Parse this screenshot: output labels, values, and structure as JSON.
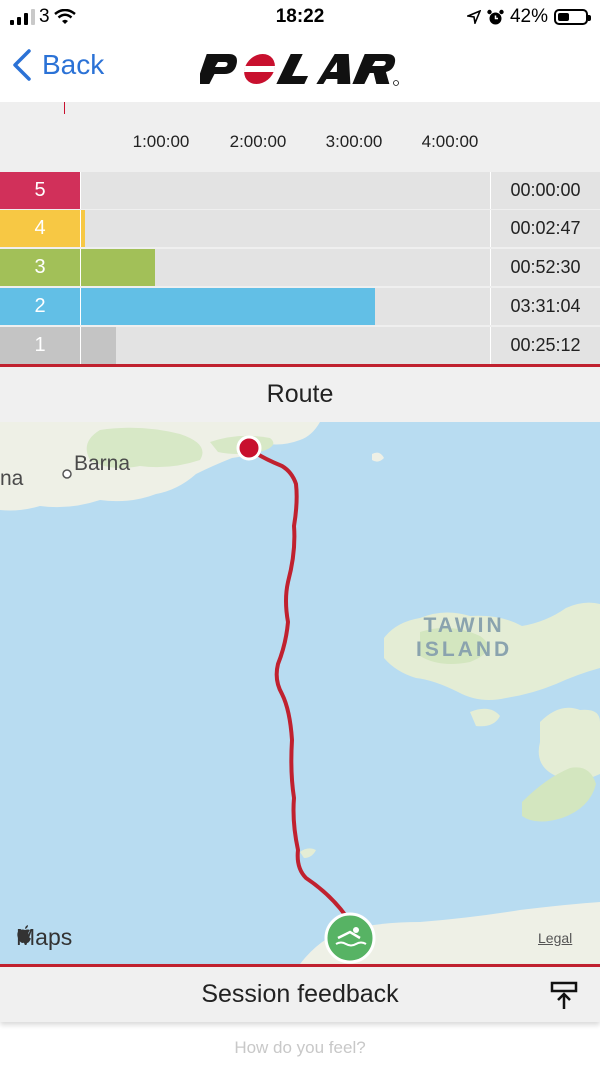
{
  "status_bar": {
    "carrier": "3",
    "time": "18:22",
    "battery_percent": "42%",
    "battery_level": 0.42,
    "icons": [
      "signal-bars-icon",
      "wifi-icon",
      "location-arrow-icon",
      "alarm-clock-icon",
      "battery-icon"
    ]
  },
  "nav": {
    "back_label": "Back",
    "brand": "POLAR"
  },
  "zones": {
    "axis_ticks": [
      "1:00:00",
      "2:00:00",
      "3:00:00",
      "4:00:00"
    ],
    "rows": [
      {
        "zone": "5",
        "time": "00:00:00",
        "fraction": 0.0,
        "color": "#d1305a"
      },
      {
        "zone": "4",
        "time": "00:02:47",
        "fraction": 0.011,
        "color": "#f7c844"
      },
      {
        "zone": "3",
        "time": "00:52:30",
        "fraction": 0.18,
        "color": "#a2c058"
      },
      {
        "zone": "2",
        "time": "03:31:04",
        "fraction": 0.72,
        "color": "#62bfe6"
      },
      {
        "zone": "1",
        "time": "00:25:12",
        "fraction": 0.086,
        "color": "#c4c4c4"
      }
    ]
  },
  "route": {
    "title": "Route",
    "place_labels": [
      "na",
      "Barna"
    ],
    "island_label_line1": "TAWIN",
    "island_label_line2": "ISLAND",
    "maps_credit": "Maps",
    "legal": "Legal",
    "route_color": "#c0212f",
    "start_icon": "swimmer-icon"
  },
  "feedback": {
    "title": "Session feedback",
    "prompt": "How do you feel?"
  }
}
